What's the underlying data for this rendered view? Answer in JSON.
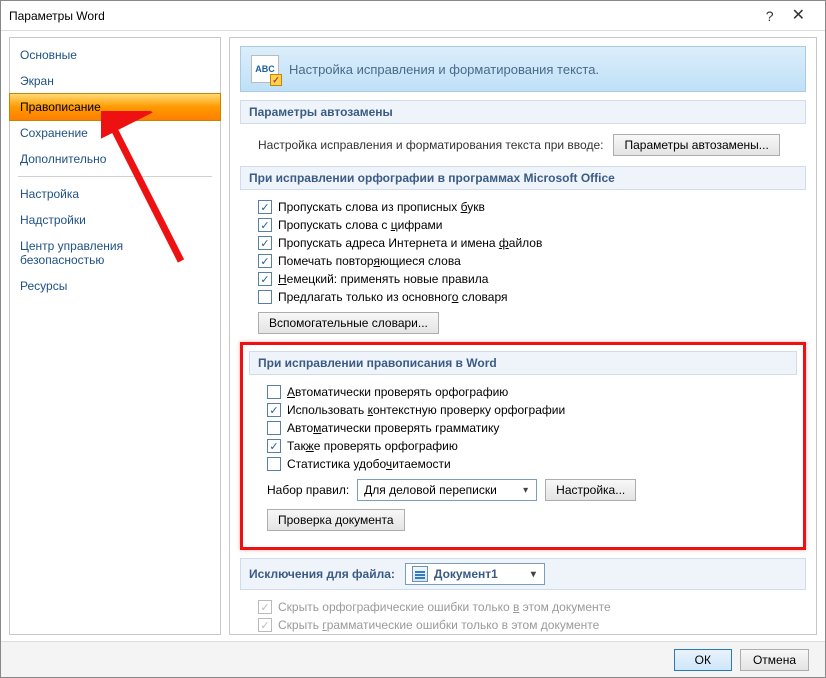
{
  "titlebar": {
    "title": "Параметры Word"
  },
  "sidebar": {
    "items": [
      {
        "label": "Основные"
      },
      {
        "label": "Экран"
      },
      {
        "label": "Правописание",
        "selected": true
      },
      {
        "label": "Сохранение"
      },
      {
        "label": "Дополнительно"
      },
      {
        "_sep": true
      },
      {
        "label": "Настройка"
      },
      {
        "label": "Надстройки"
      },
      {
        "label": "Центр управления безопасностью"
      },
      {
        "label": "Ресурсы"
      }
    ]
  },
  "header": {
    "text": "Настройка исправления и форматирования текста."
  },
  "autocorrect": {
    "title": "Параметры автозамены",
    "text": "Настройка исправления и форматирования текста при вводе:",
    "button": "Параметры автозамены..."
  },
  "office_spell": {
    "title": "При исправлении орфографии в программах Microsoft Office",
    "items": [
      {
        "checked": true,
        "label": "Пропускать слова из прописных букв",
        "u": "б"
      },
      {
        "checked": true,
        "label": "Пропускать слова с цифрами",
        "u": "ц"
      },
      {
        "checked": true,
        "label": "Пропускать адреса Интернета и имена файлов",
        "u": "ф"
      },
      {
        "checked": true,
        "label": "Помечать повторяющиеся слова",
        "u": "я"
      },
      {
        "checked": true,
        "label": "Немецкий: применять новые правила",
        "u": "Н"
      },
      {
        "checked": false,
        "label": "Предлагать только из основного словаря",
        "u": "о"
      }
    ],
    "dict_btn": "Вспомогательные словари..."
  },
  "word_spell": {
    "title": "При исправлении правописания в Word",
    "items": [
      {
        "checked": false,
        "label": "Автоматически проверять орфографию",
        "u": "А"
      },
      {
        "checked": true,
        "label": "Использовать контекстную проверку орфографии",
        "u": "к"
      },
      {
        "checked": false,
        "label": "Автоматически проверять грамматику",
        "u": "м"
      },
      {
        "checked": true,
        "label": "Также проверять орфографию",
        "u": "ж"
      },
      {
        "checked": false,
        "label": "Статистика удобочитаемости",
        "u": "ч"
      }
    ],
    "ruleset_label": "Набор правил:",
    "ruleset_value": "Для деловой переписки",
    "settings_btn": "Настройка...",
    "check_doc_btn": "Проверка документа"
  },
  "exceptions": {
    "title": "Исключения для файла:",
    "file": "Документ1",
    "items": [
      {
        "label": "Скрыть орфографические ошибки только в этом документе",
        "u": "в"
      },
      {
        "label": "Скрыть грамматические ошибки только в этом документе",
        "u": "г"
      }
    ]
  },
  "footer": {
    "ok": "ОК",
    "cancel": "Отмена"
  }
}
